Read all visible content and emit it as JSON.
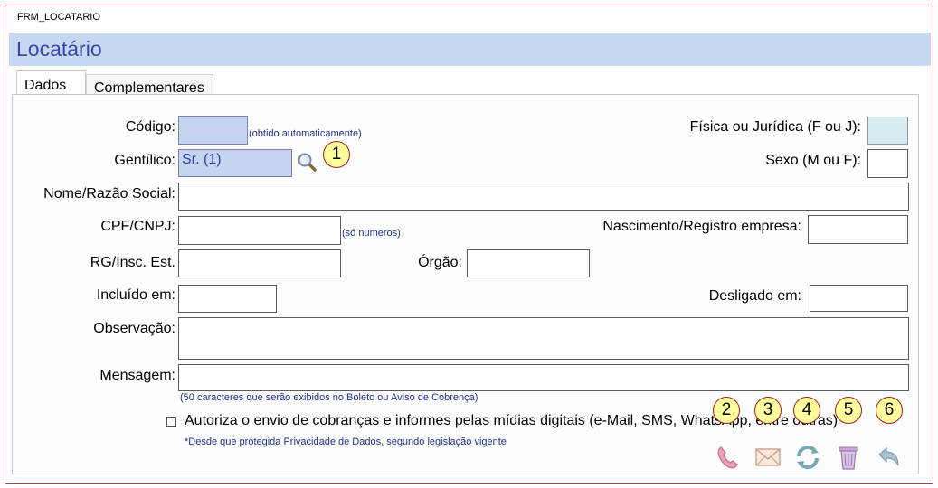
{
  "window": {
    "title": "FRM_LOCATARIO"
  },
  "header": {
    "title": "Locatário"
  },
  "tabs": [
    {
      "label": "Dados",
      "active": true
    },
    {
      "label": "Complementares",
      "active": false
    }
  ],
  "form": {
    "codigo": {
      "label": "Código:",
      "value": "",
      "note": "(obtido automaticamente)"
    },
    "fisica_juridica": {
      "label": "Física ou Jurídica (F ou J):",
      "value": ""
    },
    "gentilico": {
      "label": "Gentílico:",
      "value": "Sr. (1)"
    },
    "sexo": {
      "label": "Sexo (M ou F):",
      "value": ""
    },
    "nome": {
      "label": "Nome/Razão Social:",
      "value": ""
    },
    "cpf": {
      "label": "CPF/CNPJ:",
      "value": "",
      "note": "(só numeros)"
    },
    "nascimento": {
      "label": "Nascimento/Registro empresa:",
      "value": ""
    },
    "rg": {
      "label": "RG/Insc. Est.",
      "value": ""
    },
    "orgao": {
      "label": "Órgão:",
      "value": ""
    },
    "incluido": {
      "label": "Incluído em:",
      "value": ""
    },
    "desligado": {
      "label": "Desligado em:",
      "value": ""
    },
    "observacao": {
      "label": "Observação:",
      "value": ""
    },
    "mensagem": {
      "label": "Mensagem:",
      "value": "",
      "note": "(50 caracteres que serão exibidos no Boleto ou Aviso de Cobrença)"
    },
    "consent": {
      "checked": false,
      "label": "Autoriza o envio de cobranças e  informes pelas mídias digitais (e-Mail, SMS, WhatsApp, entre outras)",
      "note": "*Desde que protegida Privacidade de Dados, segundo legislação vigente"
    }
  },
  "badges": [
    "1",
    "2",
    "3",
    "4",
    "5",
    "6"
  ],
  "toolbar": {
    "icons": [
      "phone-icon",
      "envelope-icon",
      "refresh-icon",
      "trash-icon",
      "undo-icon"
    ]
  },
  "colors": {
    "header_bg": "#c5d9f1",
    "header_text": "#3848a8",
    "window_border": "#a5404f",
    "badge_fill": "#ffff9e",
    "badge_border": "#b01818",
    "field_auto_bg": "#c5d5f0"
  }
}
